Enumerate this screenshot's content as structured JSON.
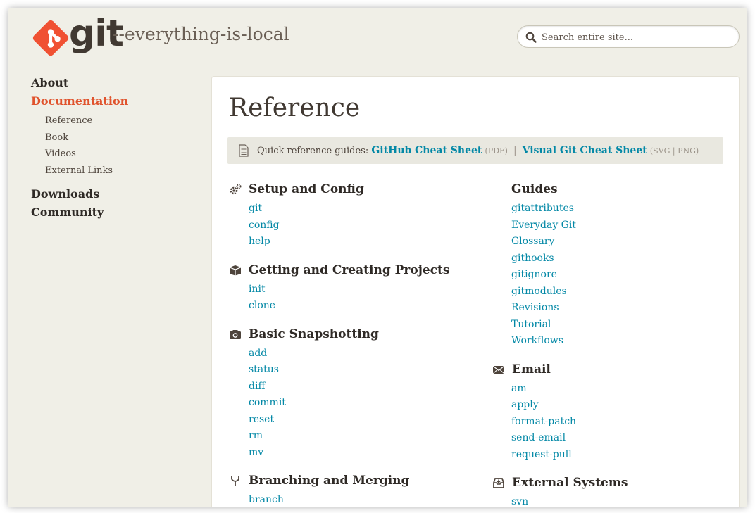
{
  "header": {
    "brand": "git",
    "tagline": "--everything-is-local",
    "search_placeholder": "Search entire site..."
  },
  "sidebar": {
    "about": "About",
    "documentation": "Documentation",
    "sub": [
      "Reference",
      "Book",
      "Videos",
      "External Links"
    ],
    "downloads": "Downloads",
    "community": "Community"
  },
  "main": {
    "title": "Reference",
    "quickref": {
      "prefix": "Quick reference guides:",
      "github_link": "GitHub Cheat Sheet",
      "github_fmt": "(PDF)",
      "sep": "|",
      "visual_link": "Visual Git Cheat Sheet",
      "visual_fmt": "(SVG | PNG)"
    },
    "left_sections": [
      {
        "title": "Setup and Config",
        "icon": "gears-icon",
        "links": [
          "git",
          "config",
          "help"
        ]
      },
      {
        "title": "Getting and Creating Projects",
        "icon": "box-icon",
        "links": [
          "init",
          "clone"
        ]
      },
      {
        "title": "Basic Snapshotting",
        "icon": "camera-icon",
        "links": [
          "add",
          "status",
          "diff",
          "commit",
          "reset",
          "rm",
          "mv"
        ]
      },
      {
        "title": "Branching and Merging",
        "icon": "branch-icon",
        "links": [
          "branch"
        ]
      }
    ],
    "right_sections": [
      {
        "title": "Guides",
        "links": [
          "gitattributes",
          "Everyday Git",
          "Glossary",
          "githooks",
          "gitignore",
          "gitmodules",
          "Revisions",
          "Tutorial",
          "Workflows"
        ]
      },
      {
        "title": "Email",
        "icon": "envelope-icon",
        "links": [
          "am",
          "apply",
          "format-patch",
          "send-email",
          "request-pull"
        ]
      },
      {
        "title": "External Systems",
        "icon": "inbox-icon",
        "links": [
          "svn"
        ]
      }
    ]
  },
  "colors": {
    "accent": "#e0532d",
    "link": "#0388a6",
    "background": "#f0efe7"
  }
}
